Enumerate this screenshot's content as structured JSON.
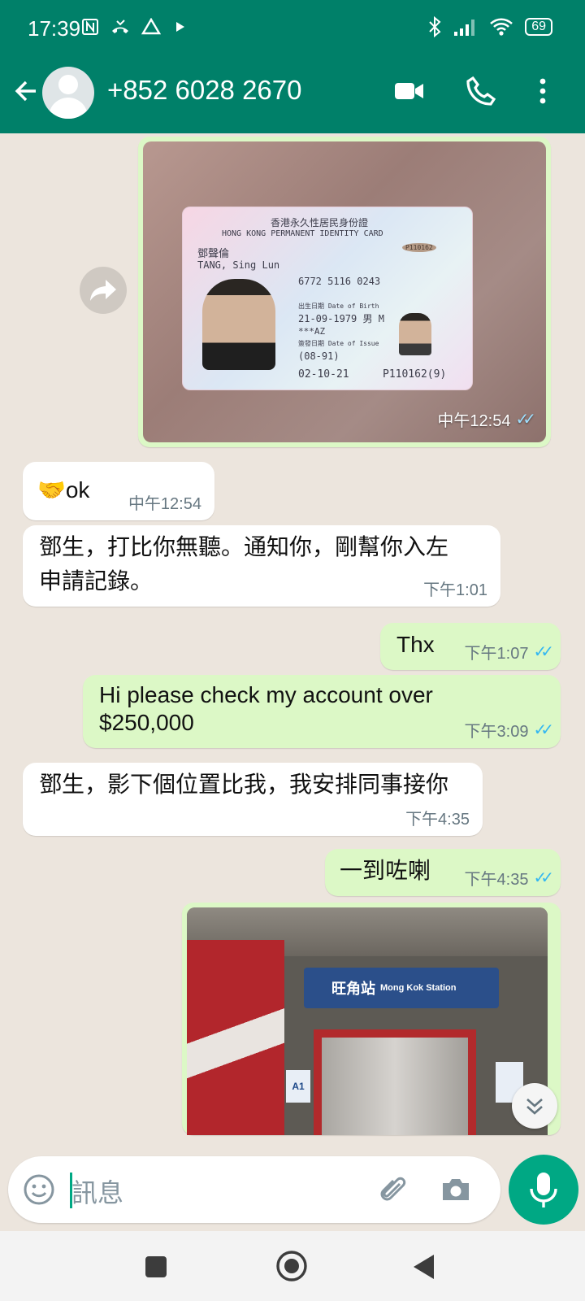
{
  "status_bar": {
    "time": "17:39",
    "battery": "69"
  },
  "header": {
    "contact": "+852 6028 2670"
  },
  "id_card": {
    "title_cn": "香港永久性居民身份證",
    "title_en": "HONG KONG PERMANENT IDENTITY CARD",
    "name_cn": "鄧聲倫",
    "name_en": "TANG, Sing Lun",
    "code": "6772 5116 0243",
    "dob_label": "出生日期 Date of Birth",
    "dob": "21-09-1979  男 M",
    "symbols": "***AZ",
    "issue_label": "簽發日期 Date of Issue",
    "first_issue": "(08-91)",
    "issue": "02-10-21",
    "number": "P110162(9)",
    "stamp": "P110162"
  },
  "station_sign": {
    "cn": "旺角站",
    "en": "Mong Kok Station",
    "platform": "A1"
  },
  "messages": [
    {
      "id": "m1",
      "dir": "out",
      "kind": "image",
      "time": "中午12:54"
    },
    {
      "id": "m2",
      "dir": "in",
      "kind": "text",
      "text": "🤝ok",
      "time": "中午12:54"
    },
    {
      "id": "m3",
      "dir": "in",
      "kind": "text",
      "text": "鄧生，打比你無聽。通知你，剛幫你入左申請記錄。",
      "time": "下午1:01"
    },
    {
      "id": "m4",
      "dir": "out",
      "kind": "text",
      "text": "Thx",
      "time": "下午1:07"
    },
    {
      "id": "m5",
      "dir": "out",
      "kind": "text",
      "text": "Hi please check my account over $250,000",
      "time": "下午3:09"
    },
    {
      "id": "m6",
      "dir": "in",
      "kind": "text",
      "text": "鄧生，影下個位置比我，我安排同事接你",
      "time": "下午4:35"
    },
    {
      "id": "m7",
      "dir": "out",
      "kind": "text",
      "text": "一到咗喇",
      "time": "下午4:35"
    },
    {
      "id": "m8",
      "dir": "out",
      "kind": "image"
    }
  ],
  "input": {
    "placeholder": "訊息"
  },
  "colors": {
    "header": "#008069",
    "outgoing_bubble": "#dcf8c6",
    "incoming_bubble": "#ffffff",
    "read_ticks": "#34b7f1",
    "accent": "#00a884",
    "chat_bg": "#ece5dd"
  },
  "icons": [
    "back-arrow-icon",
    "avatar-icon",
    "video-call-icon",
    "phone-icon",
    "more-options-icon",
    "forward-icon",
    "scroll-down-icon",
    "emoji-icon",
    "attach-icon",
    "camera-icon",
    "mic-icon",
    "nav-recent-icon",
    "nav-home-icon",
    "nav-back-icon"
  ]
}
